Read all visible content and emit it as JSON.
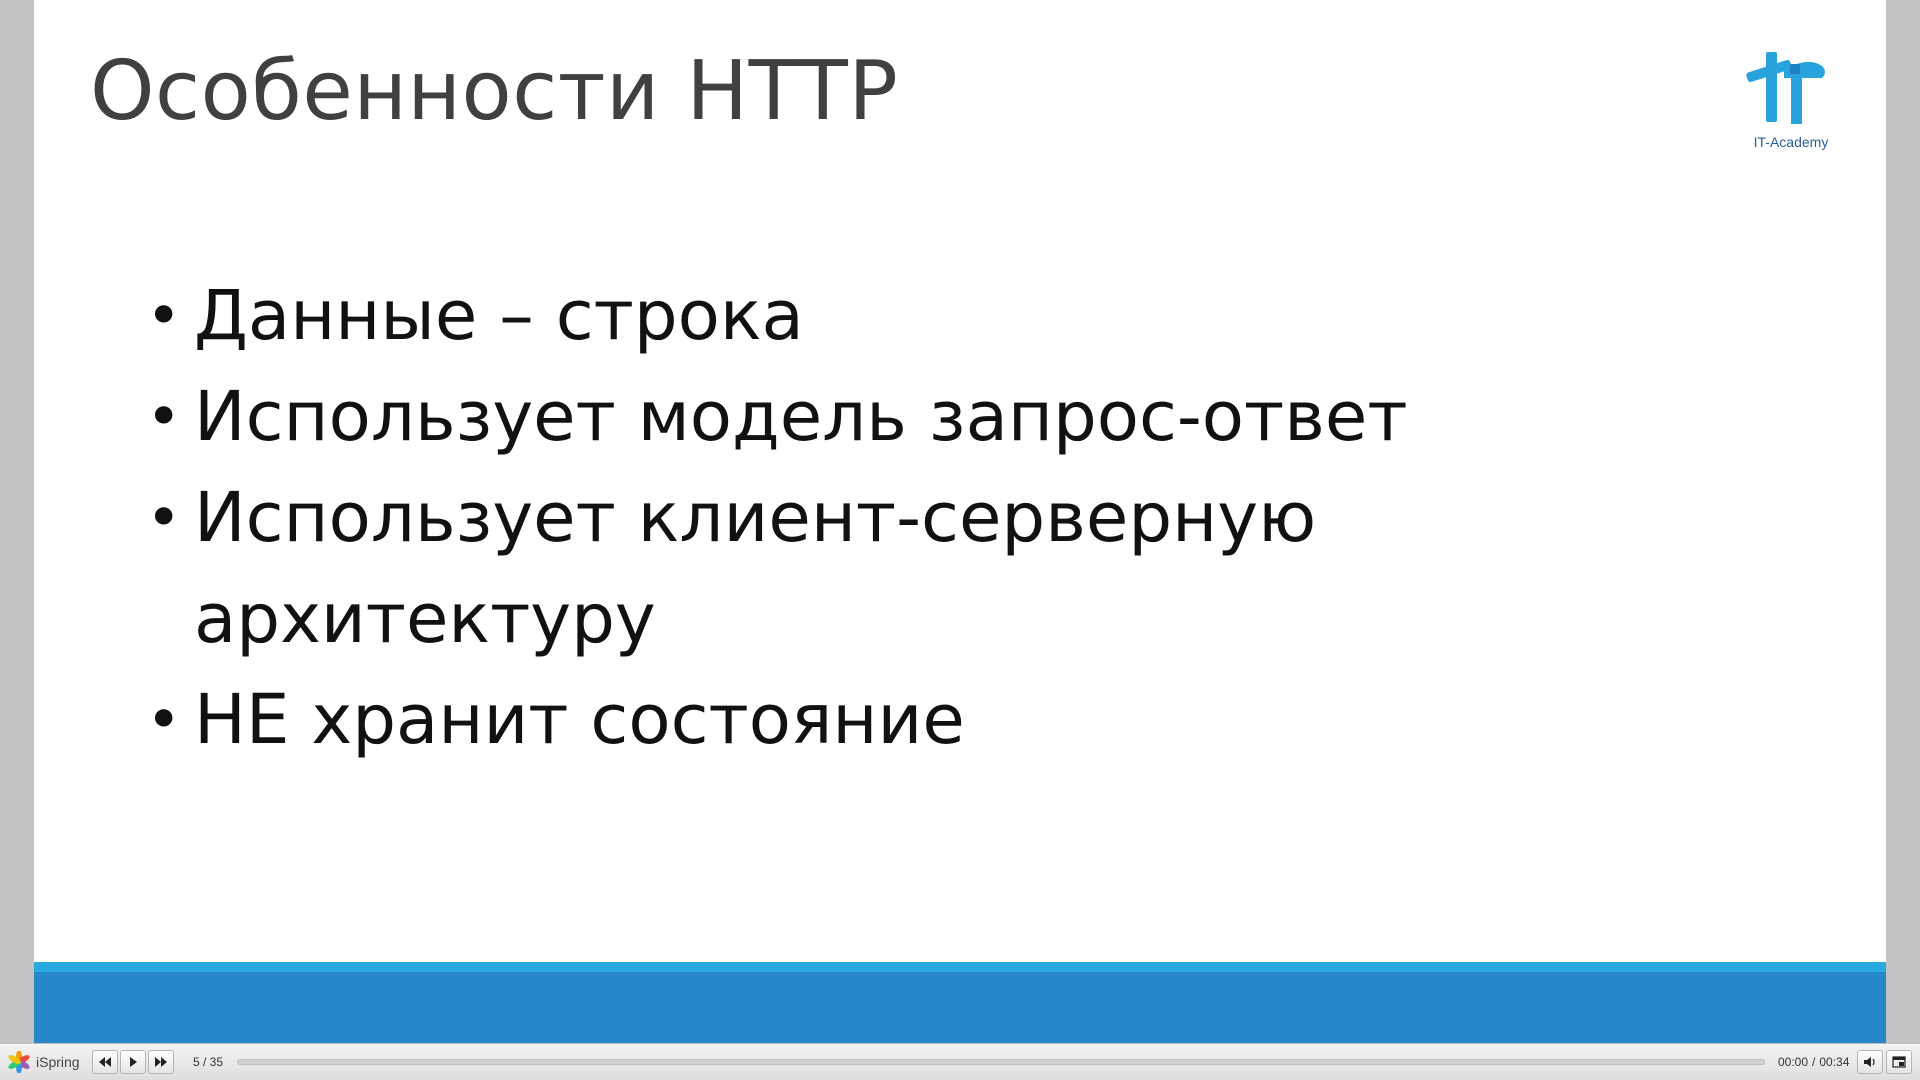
{
  "slide": {
    "title": "Особенности HTTP",
    "logo_text": "IT-Academy",
    "bullets": [
      "Данные – строка",
      "Использует модель запрос-ответ",
      "Использует клиент-серверную",
      "архитектуру",
      "НЕ хранит состояние"
    ],
    "bullet_symbol": "•",
    "colors": {
      "accent_light": "#29abe2",
      "accent_dark": "#2787cb",
      "title_text": "#404040",
      "logo": "#29a3dc"
    }
  },
  "player": {
    "brand_label": "iSpring",
    "brand_icon": "ispring-flower-icon",
    "prev_icon": "rewind-icon",
    "play_icon": "play-icon",
    "next_icon": "fast-forward-icon",
    "slide_counter": "5 / 35",
    "current_time": "00:00",
    "total_time": "00:34",
    "time_separator": "/",
    "progress": 0,
    "volume_icon": "speaker-icon",
    "layout_icon": "layout-toggle-icon"
  }
}
